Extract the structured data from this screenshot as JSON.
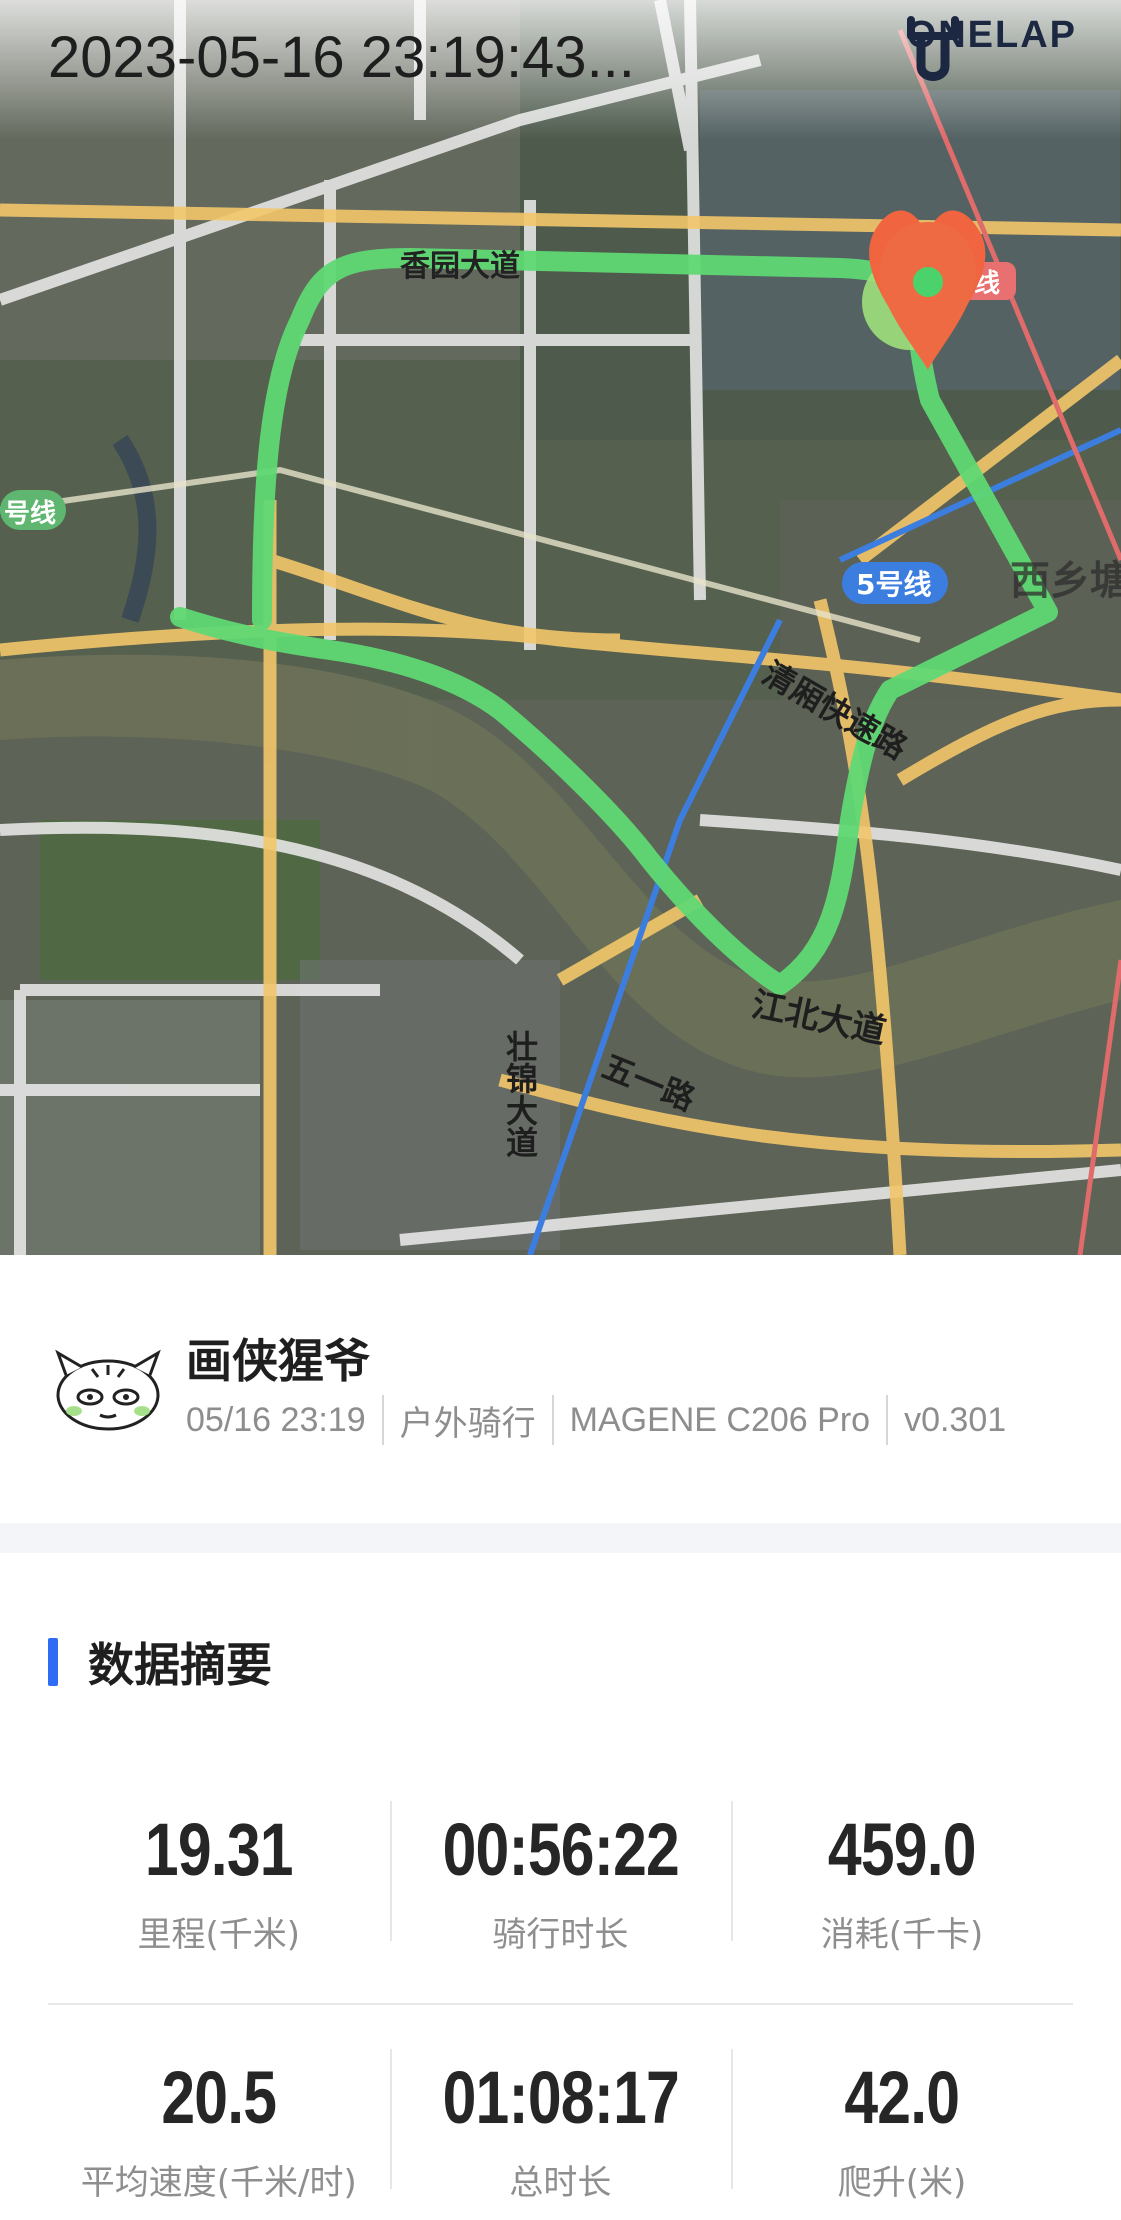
{
  "header": {
    "datetime": "2023-05-16 23:19:43...",
    "brand": "ONELAP"
  },
  "map": {
    "route_color": "#5fd873",
    "labels": {
      "road_top": "香园大道",
      "line_left": "号线",
      "line_right": "号线",
      "line_5": "5号线",
      "district": "西乡塘",
      "road_qingxiang": "清厢快速路",
      "road_jiangbei": "江北大道",
      "road_zhuangjin": "壮锦大道",
      "road_wuyi": "五一路"
    }
  },
  "profile": {
    "name": "画侠猩爷",
    "date": "05/16 23:19",
    "sport": "户外骑行",
    "device": "MAGENE C206 Pro",
    "version": "v0.301"
  },
  "summary": {
    "title": "数据摘要",
    "accent": "#2f6bf5",
    "stats": [
      {
        "value": "19.31",
        "label": "里程(千米)"
      },
      {
        "value": "00:56:22",
        "label": "骑行时长"
      },
      {
        "value": "459.0",
        "label": "消耗(千卡)"
      },
      {
        "value": "20.5",
        "label": "平均速度(千米/时)"
      },
      {
        "value": "01:08:17",
        "label": "总时长"
      },
      {
        "value": "42.0",
        "label": "爬升(米)"
      }
    ]
  }
}
